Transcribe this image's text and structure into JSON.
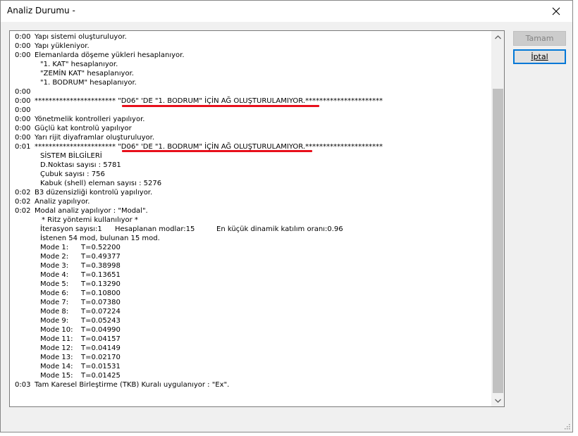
{
  "window": {
    "title": "Analiz Durumu -"
  },
  "buttons": {
    "ok": "Tamam",
    "cancel": "İptal"
  },
  "log": {
    "l1": {
      "time": "0:00",
      "text": "Yapı sistemi oluşturuluyor."
    },
    "l2": {
      "time": "0:00",
      "text": "Yapı yükleniyor."
    },
    "l3": {
      "time": "0:00",
      "text": "Elemanlarda döşeme yükleri hesaplanıyor."
    },
    "l4": {
      "text": "\"1. KAT\" hesaplanıyor."
    },
    "l5": {
      "text": "\"ZEMİN KAT\" hesaplanıyor."
    },
    "l6": {
      "text": "\"1. BODRUM\" hesaplanıyor."
    },
    "l7": {
      "time": "0:00"
    },
    "l8": {
      "time": "0:00",
      "stars_a": "*********************** ",
      "msg": "\"D06\" 'DE \"1. BODRUM\" İÇİN AĞ OLUŞTURULAMIYOR.",
      "stars_b": "**********************"
    },
    "l9": {
      "time": "0:00"
    },
    "l10": {
      "time": "0:00",
      "text": "Yönetmelik kontrolleri yapılıyor."
    },
    "l11": {
      "time": "0:00",
      "text": "Güçlü kat kontrolü yapılıyor"
    },
    "l12": {
      "time": "0:00",
      "text": "Yarı rijit diyaframlar oluşturuluyor."
    },
    "l13": {
      "time": "0:01",
      "stars_a": "*********************** ",
      "msg": "\"D06\" 'DE \"1. BODRUM\" İÇİN AĞ OLUŞTURULAMIYOR.",
      "stars_b": "**********************"
    },
    "l14": {
      "text": "SİSTEM BİLGİLERİ"
    },
    "l15": {
      "text": "D.Noktası sayısı : 5781"
    },
    "l16": {
      "text": "Çubuk sayısı : 756"
    },
    "l17": {
      "text": "Kabuk (shell) eleman sayısı : 5276"
    },
    "l18": {
      "time": "0:02",
      "text": "B3 düzensizliği kontrolü yapılıyor."
    },
    "l19": {
      "time": "0:02",
      "text": "Analiz yapılıyor."
    },
    "l20": {
      "time": "0:02",
      "text": "Modal analiz yapılıyor : \"Modal\"."
    },
    "l21": {
      "text": "* Ritz yöntemi kullanılıyor *"
    },
    "l22": {
      "a": "İterasyon sayısı:1",
      "b": "Hesaplanan modlar:15",
      "c": "En küçük dinamik katılım oranı:0.96"
    },
    "l23": {
      "text": "İstenen 54 mod, bulunan 15 mod."
    },
    "l24": {
      "time": "0:03",
      "text": "Tam Karesel Birleştirme (TKB) Kuralı uygulanıyor : \"Ex\"."
    }
  },
  "modes": [
    {
      "label": "Mode 1:",
      "period": "T=0.52200"
    },
    {
      "label": "Mode 2:",
      "period": "T=0.49377"
    },
    {
      "label": "Mode 3:",
      "period": "T=0.38998"
    },
    {
      "label": "Mode 4:",
      "period": "T=0.13651"
    },
    {
      "label": "Mode 5:",
      "period": "T=0.13290"
    },
    {
      "label": "Mode 6:",
      "period": "T=0.10800"
    },
    {
      "label": "Mode 7:",
      "period": "T=0.07380"
    },
    {
      "label": "Mode 8:",
      "period": "T=0.07224"
    },
    {
      "label": "Mode 9:",
      "period": "T=0.05243"
    },
    {
      "label": "Mode 10:",
      "period": "T=0.04990"
    },
    {
      "label": "Mode 11:",
      "period": "T=0.04157"
    },
    {
      "label": "Mode 12:",
      "period": "T=0.04149"
    },
    {
      "label": "Mode 13:",
      "period": "T=0.02170"
    },
    {
      "label": "Mode 14:",
      "period": "T=0.01531"
    },
    {
      "label": "Mode 15:",
      "period": "T=0.01425"
    }
  ],
  "colors": {
    "highlight_underline": "#e8101c",
    "focus_border": "#0078d7"
  },
  "icons": {
    "close": "close-icon",
    "scroll_up": "chevron-up-icon",
    "scroll_down": "chevron-down-icon",
    "resize": "resize-grip-icon"
  }
}
